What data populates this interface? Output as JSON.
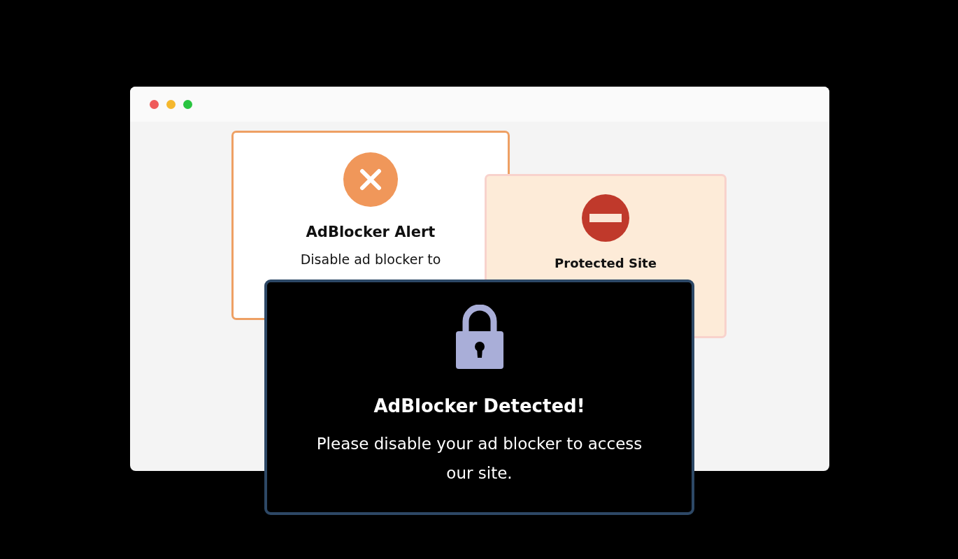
{
  "browser": {
    "kind": "window"
  },
  "popups": [
    {
      "kind": "alert",
      "title": "AdBlocker Alert",
      "text": "Disable ad blocker to"
    },
    {
      "kind": "notice",
      "title": "Protected Site"
    },
    {
      "kind": "modal",
      "title": "AdBlocker Detected!",
      "text": "Please disable your ad blocker to access our site."
    }
  ]
}
